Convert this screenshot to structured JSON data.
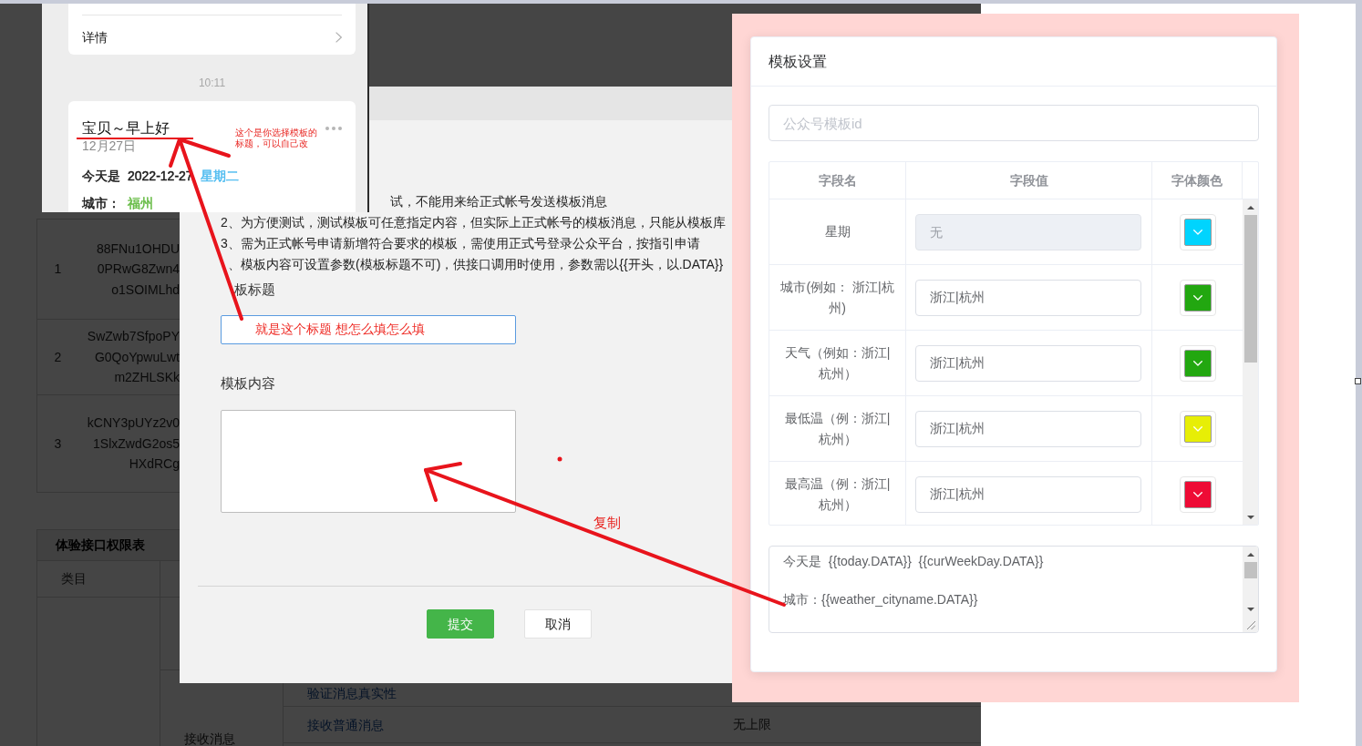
{
  "background_page": {
    "id_table": {
      "rows": [
        {
          "index": "1",
          "id_lines": [
            "88FNu1OHDU",
            "0PRwG8Zwn4",
            "o1SOIMLhd"
          ]
        },
        {
          "index": "2",
          "id_lines": [
            "SwZwb7SfpoPY",
            "G0QoYpwuLwt",
            "m2ZHLSKk"
          ]
        },
        {
          "index": "3",
          "id_lines": [
            "kCNY3pUYz2v0",
            "1SlxZwdG2os5",
            "HXdRCg"
          ]
        }
      ]
    },
    "permission_table": {
      "title": "体验接口权限表",
      "columns": [
        "类目"
      ],
      "category": "接收消息",
      "items": [
        {
          "name": "验证消息真实性"
        },
        {
          "name": "接收普通消息",
          "limit": "无上限"
        }
      ]
    }
  },
  "phone_screenshot": {
    "detail_link": "详情",
    "time": "10:11",
    "message": {
      "title": "宝贝～早上好",
      "date": "12月27日",
      "lines": [
        {
          "segments": [
            {
              "text": "今天是",
              "color": "#1a1a1a"
            },
            {
              "text": "2022-12-27",
              "color": "#1a1a1a"
            },
            {
              "text": "星期二",
              "color": "#4fbcf0"
            }
          ]
        },
        {
          "segments": [
            {
              "text": "城市：",
              "color": "#1a1a1a"
            },
            {
              "text": "福州",
              "color": "#66bb44"
            }
          ]
        }
      ]
    }
  },
  "dialog": {
    "notes": [
      "试，不能用来给正式帐号发送模板消息",
      "2、为方便测试，测试模板可任意指定内容，但实际上正式帐号的模板消息，只能从模板库",
      "3、需为正式帐号申请新增符合要求的模板，需使用正式号登录公众平台，按指引申请",
      "、模板内容可设置参数(模板标题不可)，供接口调用时使用，参数需以{{开头，以.DATA}}"
    ],
    "title_field": {
      "label": "板标题",
      "value": "就是这个标题 想怎么填怎么填"
    },
    "content_field": {
      "label": "模板内容"
    },
    "buttons": [
      {
        "label": "提交",
        "kind": "primary"
      },
      {
        "label": "取消",
        "kind": "default"
      }
    ]
  },
  "template_settings": {
    "title": "模板设置",
    "template_id": {
      "placeholder": "公众号模板id"
    },
    "columns": [
      "字段名",
      "字段值",
      "字体颜色"
    ],
    "rows": [
      {
        "name": "星期",
        "placeholder": "无",
        "disabled": true,
        "color": "#00d4fe"
      },
      {
        "name": "城市(例如： 浙江|杭州)",
        "value": "浙江|杭州",
        "disabled": false,
        "color": "#22a710"
      },
      {
        "name": "天气（例如：浙江|杭州）",
        "value": "浙江|杭州",
        "disabled": false,
        "color": "#22a710"
      },
      {
        "name": "最低温（例：浙江|杭州）",
        "value": "浙江|杭州",
        "disabled": false,
        "color": "#e7ee06"
      },
      {
        "name": "最高温（例：浙江|杭州）",
        "value": "浙江|杭州",
        "disabled": false,
        "color": "#ee0b35"
      }
    ],
    "content_lines": [
      "今天是  {{today.DATA}}  {{curWeekDay.DATA}}",
      "城市：{{weather_cityname.DATA}}"
    ]
  },
  "annotations": {
    "note": "这个是你选择模板的标题，可以自己改",
    "label": "复制"
  }
}
